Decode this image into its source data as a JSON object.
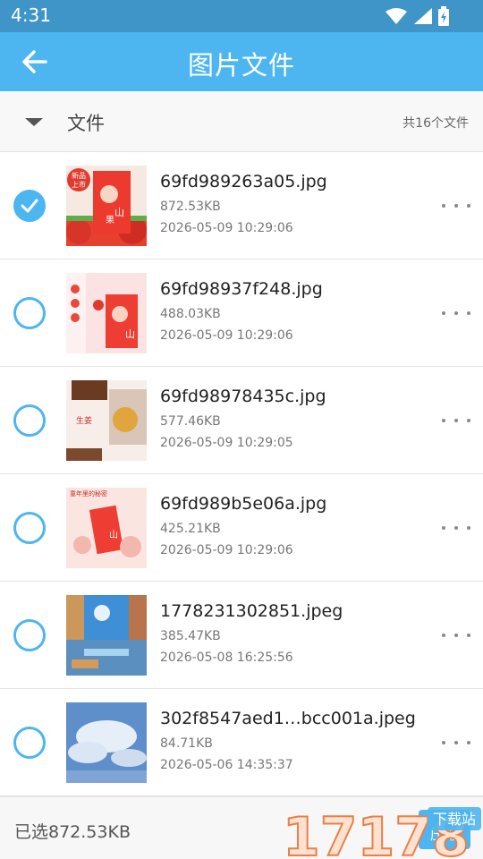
{
  "status_bar": {
    "time": "4:31",
    "icons": [
      "wifi-icon",
      "signal-icon",
      "battery-icon"
    ]
  },
  "app_bar": {
    "title": "图片文件",
    "back_icon": "arrow-left-icon"
  },
  "section": {
    "label": "文件",
    "count": "共16个文件"
  },
  "files": [
    {
      "name": "69fd989263a05.jpg",
      "size": "872.53KB",
      "date": "2026-05-09 10:29:06",
      "selected": true
    },
    {
      "name": "69fd98937f248.jpg",
      "size": "488.03KB",
      "date": "2026-05-09 10:29:06",
      "selected": false
    },
    {
      "name": "69fd98978435c.jpg",
      "size": "577.46KB",
      "date": "2026-05-09 10:29:05",
      "selected": false
    },
    {
      "name": "69fd989b5e06a.jpg",
      "size": "425.21KB",
      "date": "2026-05-09 10:29:06",
      "selected": false
    },
    {
      "name": "1778231302851.jpeg",
      "size": "385.47KB",
      "date": "2026-05-08 16:25:56",
      "selected": false
    },
    {
      "name": "302f8547aed1…bcc001a.jpeg",
      "size": "84.71KB",
      "date": "2026-05-06 14:35:37",
      "selected": false
    }
  ],
  "thumbnails": [
    {
      "texts": [
        "新品",
        "上市",
        "山",
        "果"
      ]
    },
    {
      "texts": [
        "山"
      ]
    },
    {
      "texts": [
        "生姜"
      ]
    },
    {
      "texts": [
        "童年里的秘密",
        "山"
      ]
    },
    {
      "texts": []
    },
    {
      "texts": []
    }
  ],
  "footer": {
    "selected_text": "已选872.53KB",
    "compress_label": "压缩"
  },
  "watermark": {
    "number": "17178",
    "tag": "下载站"
  },
  "colors": {
    "accent": "#4db5f0",
    "status_bar": "#3f95c8"
  }
}
